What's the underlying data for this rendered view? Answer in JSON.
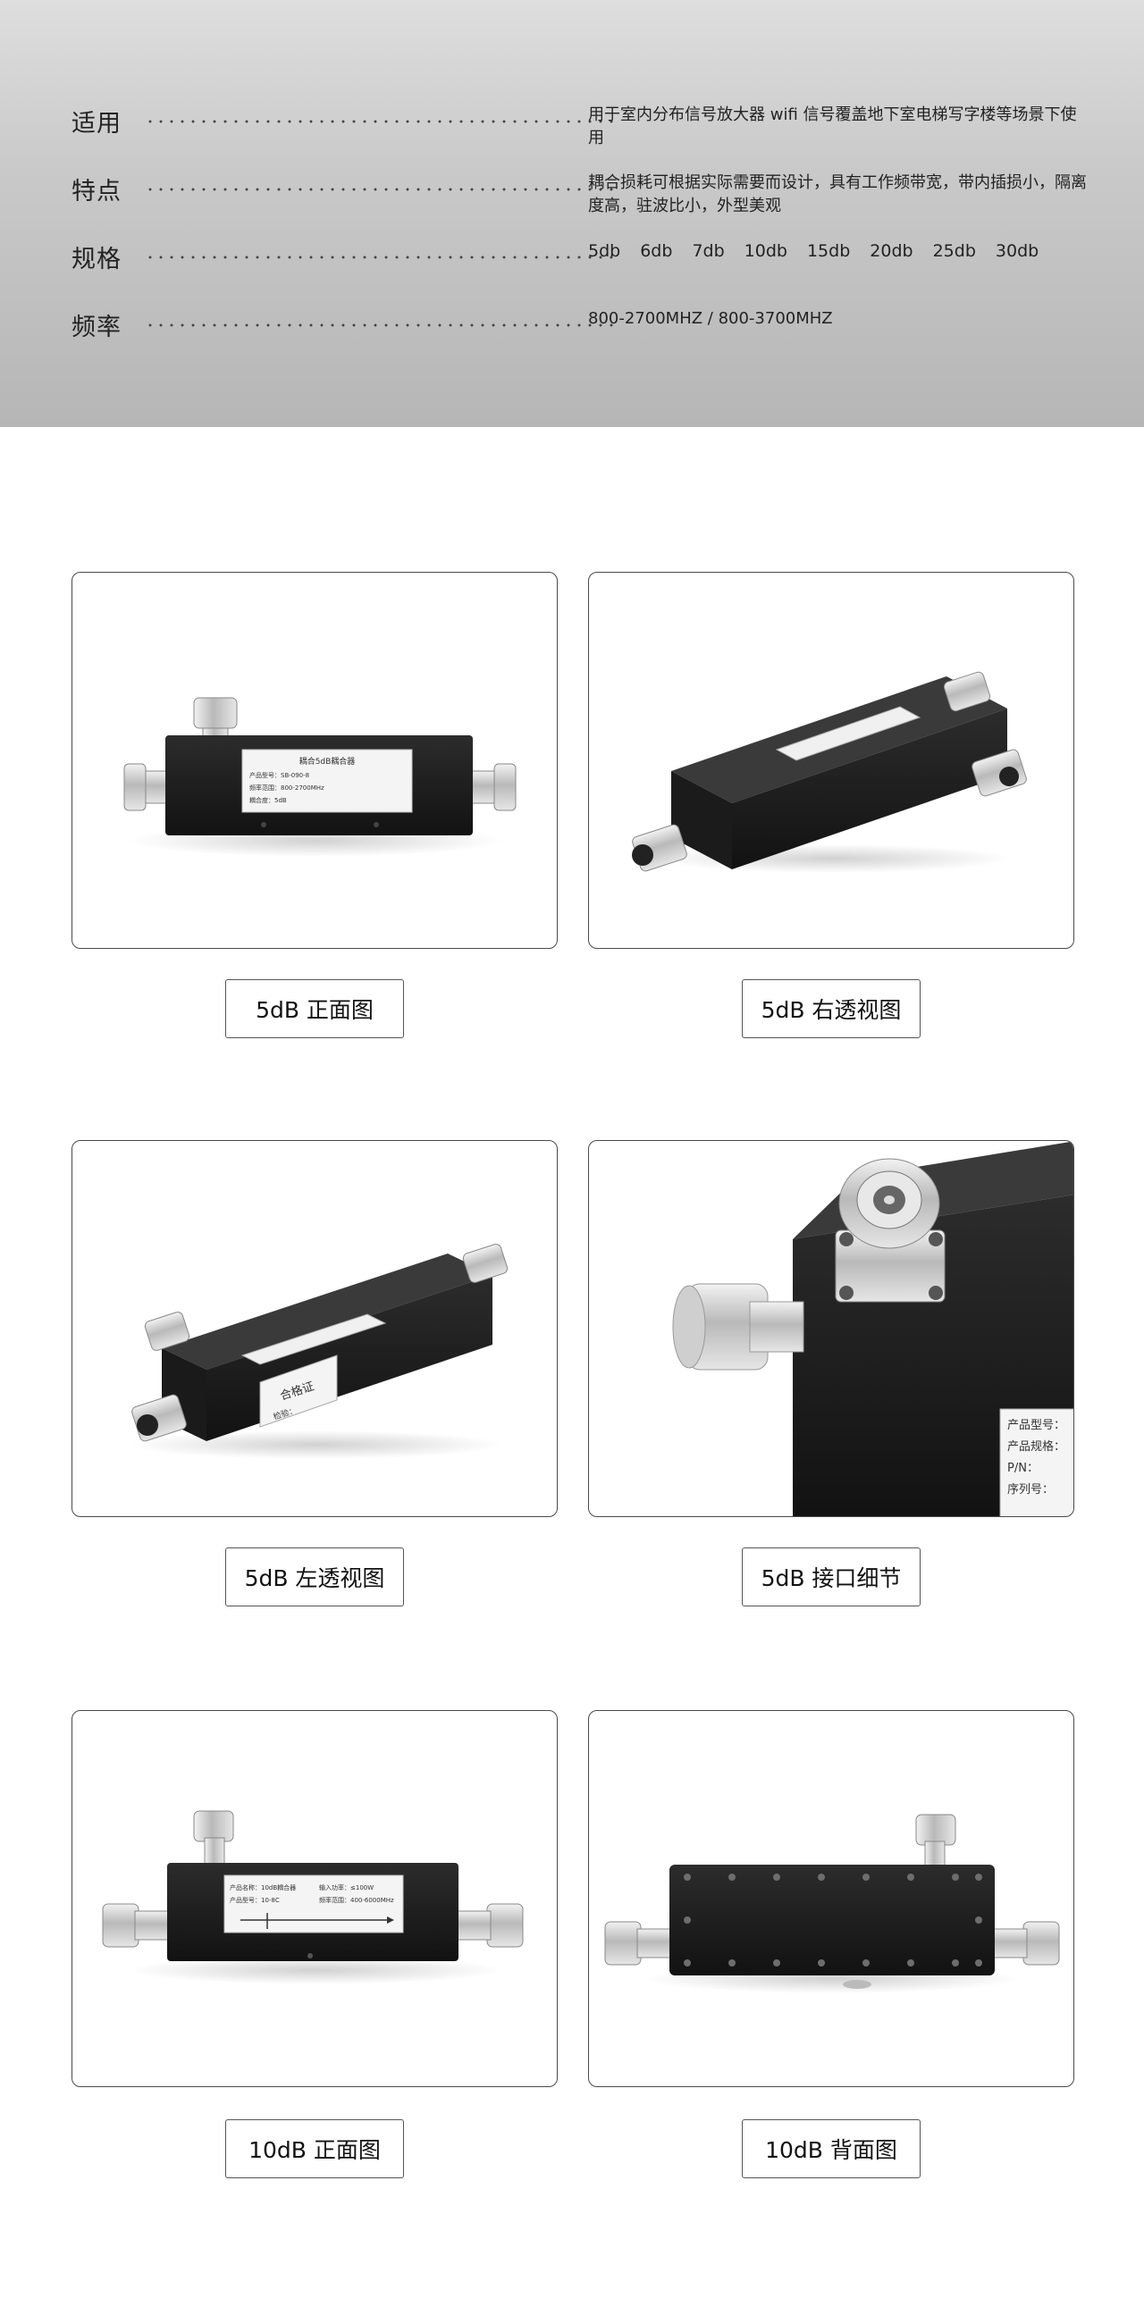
{
  "specs": [
    {
      "label": "适用",
      "value": "用于室内分布信号放大器 wifi 信号覆盖地下室电梯写字楼等场景下使用"
    },
    {
      "label": "特点",
      "value": "耦合损耗可根据实际需要而设计，具有工作频带宽，带内插损小，隔离度高，驻波比小，外型美观"
    },
    {
      "label": "规格",
      "sizes": [
        "5db",
        "6db",
        "7db",
        "10db",
        "15db",
        "20db",
        "25db",
        "30db"
      ]
    },
    {
      "label": "频率",
      "value": "800-2700MHZ / 800-3700MHZ"
    }
  ],
  "products": [
    {
      "caption": "5dB 正面图",
      "view": "front",
      "sticker": [
        "耦合5dB耦合器",
        "产品型号：SB-090-8",
        "频率范围：800-2700MHz",
        "耦合度：5dB"
      ]
    },
    {
      "caption": "5dB 右透视图",
      "view": "right-perspective"
    },
    {
      "caption": "5dB 左透视图",
      "view": "left-perspective",
      "sticker": [
        "合格证",
        "检验："
      ]
    },
    {
      "caption": "5dB 接口细节",
      "view": "connector-detail",
      "sticker": [
        "产品型号：",
        "产品规格：",
        "P/N：",
        "序列号："
      ]
    },
    {
      "caption": "10dB 正面图",
      "view": "front-10db",
      "sticker": [
        "产品名称：10dB耦合器",
        "输入功率：≤100W",
        "产品型号：10-8C",
        "频率范围：400-6000MHz"
      ]
    },
    {
      "caption": "10dB 背面图",
      "view": "back-10db"
    }
  ],
  "colors": {
    "header_top": "#dedede",
    "header_bottom": "#b6b6b6",
    "device_body": "#1c1c1c",
    "card_border": "#4a4a4a"
  }
}
